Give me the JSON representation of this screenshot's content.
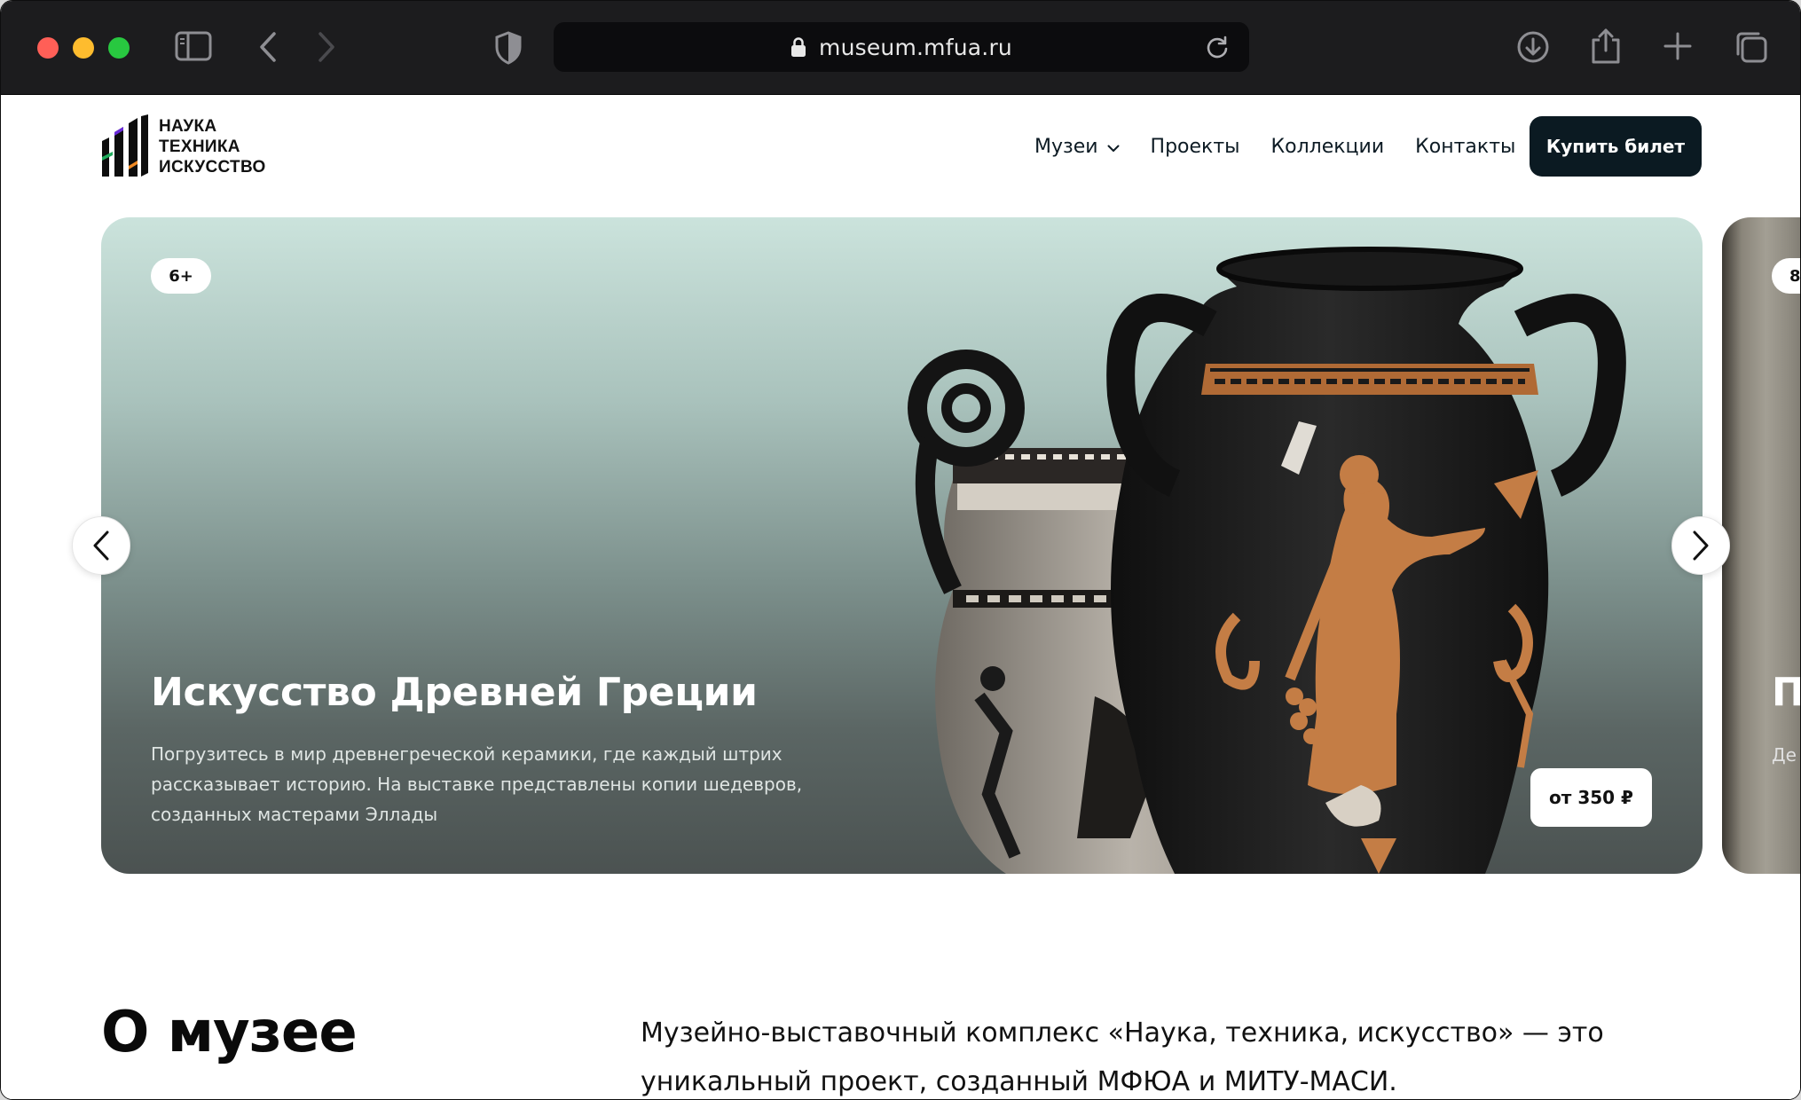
{
  "browser": {
    "url": "museum.mfua.ru"
  },
  "site": {
    "logo_lines": [
      "НАУКА",
      "ТЕХНИКА",
      "ИСКУССТВО"
    ],
    "nav": [
      {
        "label": "Музеи",
        "has_dropdown": true
      },
      {
        "label": "Проекты",
        "has_dropdown": false
      },
      {
        "label": "Коллекции",
        "has_dropdown": false
      },
      {
        "label": "Контакты",
        "has_dropdown": false
      }
    ],
    "buy_button": "Купить билет"
  },
  "hero": {
    "active_slide": {
      "age": "6+",
      "title": "Искусство Древней Греции",
      "description": "Погрузитесь в мир древнегреческой керамики, где каждый штрих рассказывает историю. На выставке представлены копии шедевров, созданных мастерами Эллады",
      "price": "от 350 ₽"
    },
    "next_slide_peek": {
      "age": "8",
      "title": "П",
      "description": "Де"
    }
  },
  "about": {
    "title": "О музее",
    "text": "Музейно-выставочный комплекс «Наука, техника, искусство» — это уникальный проект, созданный МФЮА и МИТУ-МАСИ."
  },
  "colors": {
    "brand_dark": "#0b1a22",
    "browser_chrome": "#1c1c1e"
  }
}
